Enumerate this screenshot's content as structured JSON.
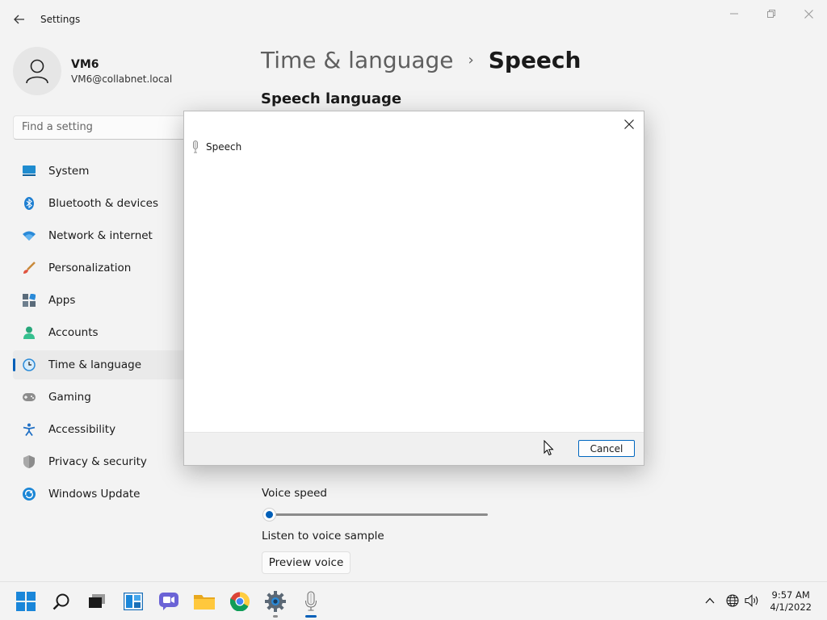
{
  "window": {
    "title": "Settings"
  },
  "user": {
    "name": "VM6",
    "email": "VM6@collabnet.local"
  },
  "search": {
    "placeholder": "Find a setting"
  },
  "nav": {
    "items": [
      {
        "label": "System"
      },
      {
        "label": "Bluetooth & devices"
      },
      {
        "label": "Network & internet"
      },
      {
        "label": "Personalization"
      },
      {
        "label": "Apps"
      },
      {
        "label": "Accounts"
      },
      {
        "label": "Time & language"
      },
      {
        "label": "Gaming"
      },
      {
        "label": "Accessibility"
      },
      {
        "label": "Privacy & security"
      },
      {
        "label": "Windows Update"
      }
    ],
    "selected": "Time & language"
  },
  "page": {
    "breadcrumb_parent": "Time & language",
    "breadcrumb_separator": "›",
    "breadcrumb_current": "Speech",
    "section_title": "Speech language",
    "voice_speed_label": "Voice speed",
    "voice_speed_value_percent": 0,
    "listen_label": "Listen to voice sample",
    "preview_button": "Preview voice"
  },
  "dialog": {
    "title": "Speech",
    "cancel_label": "Cancel"
  },
  "taskbar": {
    "time": "9:57 AM",
    "date": "4/1/2022",
    "apps": [
      "start-icon",
      "search-icon",
      "task-view-icon",
      "widgets-icon",
      "chat-icon",
      "file-explorer-icon",
      "chrome-icon",
      "settings-icon",
      "speech-mic-icon"
    ]
  },
  "colors": {
    "accent": "#005fb8",
    "background": "#f3f3f3"
  }
}
